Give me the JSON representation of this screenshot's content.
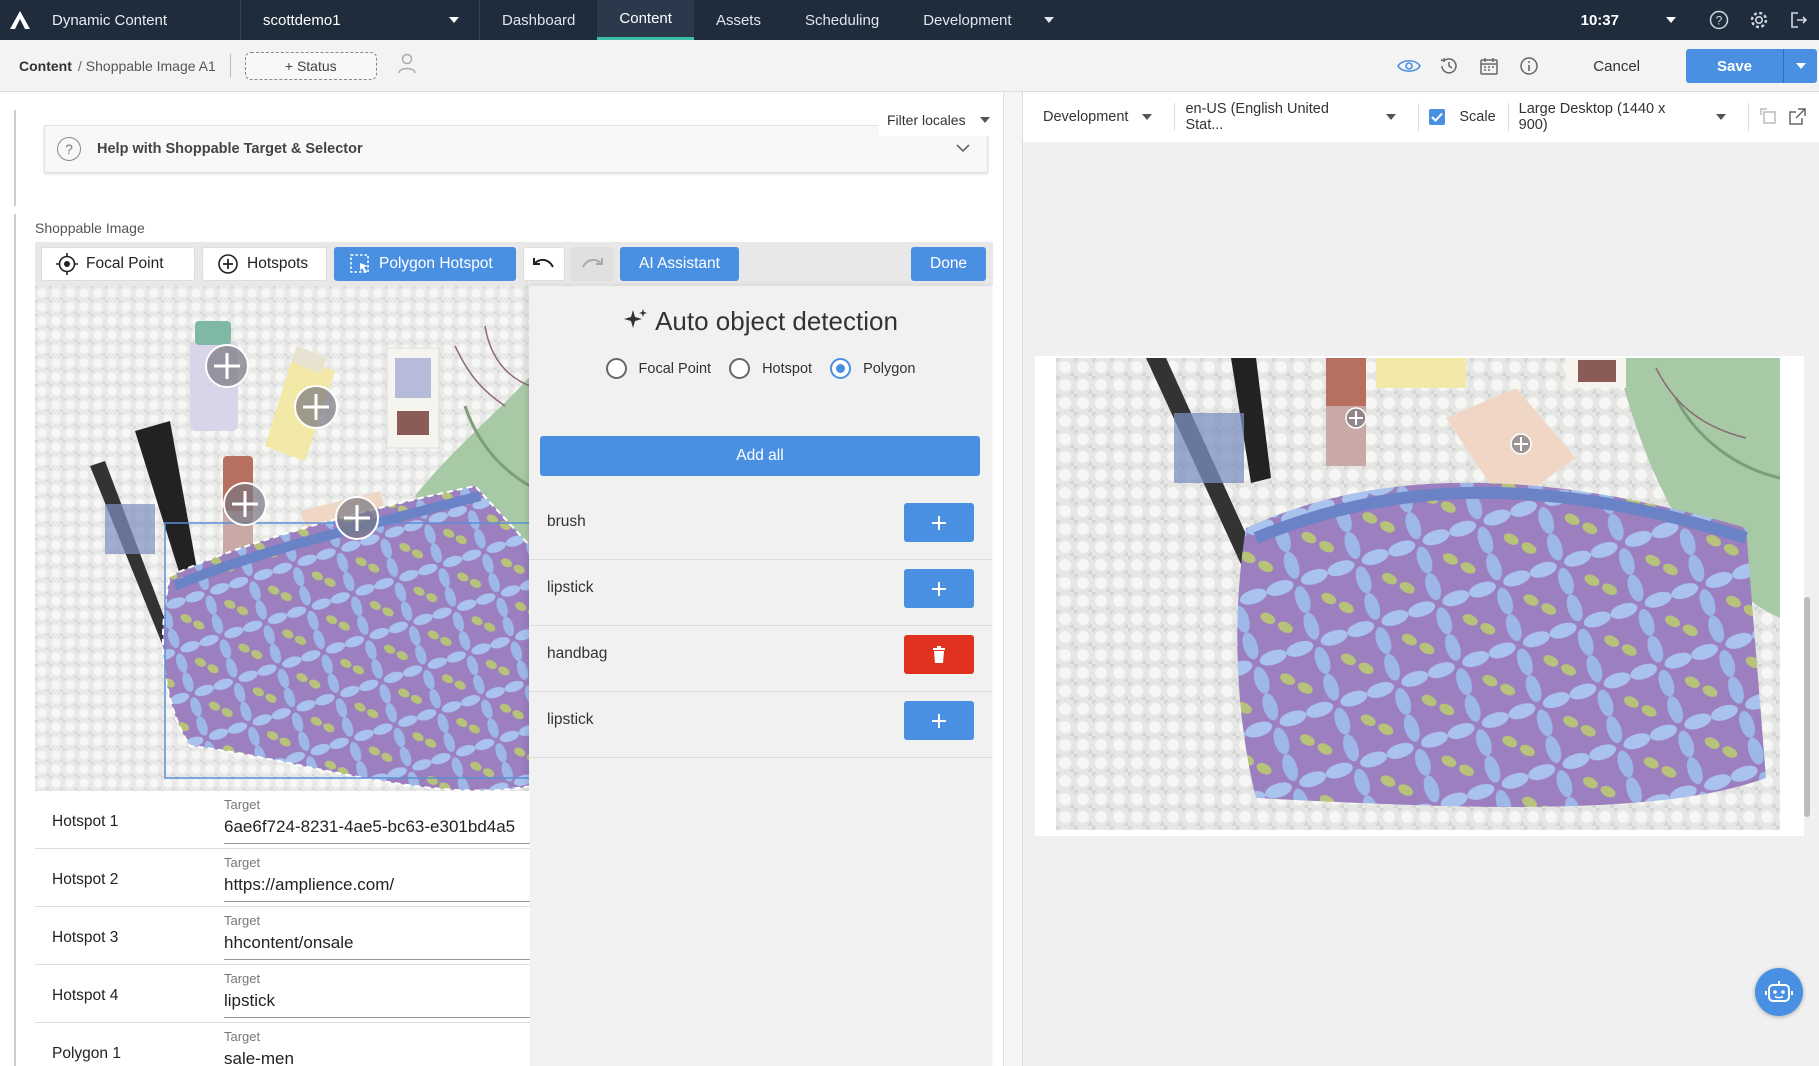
{
  "topbar": {
    "app_title": "Dynamic Content",
    "hub": "scottdemo1",
    "tabs": [
      {
        "label": "Dashboard"
      },
      {
        "label": "Content"
      },
      {
        "label": "Assets"
      },
      {
        "label": "Scheduling"
      },
      {
        "label": "Development"
      }
    ],
    "active_tab": "Content",
    "time": "10:37"
  },
  "breadcrumb": {
    "root": "Content",
    "separator": "/",
    "current": "Shoppable Image A1",
    "status_button": "+ Status",
    "cancel": "Cancel",
    "save": "Save"
  },
  "editor": {
    "filter_locales": "Filter locales",
    "help_title": "Help with Shoppable Target & Selector",
    "section_label": "Shoppable Image",
    "toolbar": {
      "focal_point": "Focal Point",
      "hotspots": "Hotspots",
      "polygon_hotspot": "Polygon Hotspot",
      "ai_assistant": "AI Assistant",
      "done": "Done"
    },
    "ai": {
      "title": "Auto object detection",
      "modes": [
        {
          "label": "Focal Point",
          "checked": false
        },
        {
          "label": "Hotspot",
          "checked": false
        },
        {
          "label": "Polygon",
          "checked": true
        }
      ],
      "add_all": "Add all",
      "detections": [
        {
          "label": "brush",
          "action": "add"
        },
        {
          "label": "lipstick",
          "action": "add"
        },
        {
          "label": "handbag",
          "action": "delete"
        },
        {
          "label": "lipstick",
          "action": "add"
        }
      ]
    },
    "hotspots": [
      {
        "name": "Hotspot 1",
        "target_label": "Target",
        "target": "6ae6f724-8231-4ae5-bc63-e301bd4a5"
      },
      {
        "name": "Hotspot 2",
        "target_label": "Target",
        "target": "https://amplience.com/"
      },
      {
        "name": "Hotspot 3",
        "target_label": "Target",
        "target": "hhcontent/onsale"
      },
      {
        "name": "Hotspot 4",
        "target_label": "Target",
        "target": "lipstick"
      },
      {
        "name": "Polygon 1",
        "target_label": "Target",
        "target": "sale-men"
      }
    ]
  },
  "preview": {
    "environment": "Development",
    "locale": "en-US (English United Stat...",
    "scale_label": "Scale",
    "scale_checked": true,
    "viewport": "Large Desktop (1440 x 900)"
  },
  "colors": {
    "nav_bg": "#1e2c3b",
    "accent": "#4a90e2",
    "active_tab_underline": "#3fbfa8",
    "danger": "#e0321e"
  },
  "icons": [
    "amplience-logo-icon",
    "chevron-down-icon",
    "help-circle-icon",
    "gear-icon",
    "logout-icon",
    "user-icon",
    "eye-icon",
    "history-icon",
    "calendar-icon",
    "info-icon",
    "target-icon",
    "plus-circle-icon",
    "polygon-select-icon",
    "undo-icon",
    "redo-icon",
    "sparkle-icon",
    "plus-icon",
    "trash-icon",
    "check-icon",
    "resize-icon",
    "external-link-icon",
    "chatbot-icon"
  ]
}
